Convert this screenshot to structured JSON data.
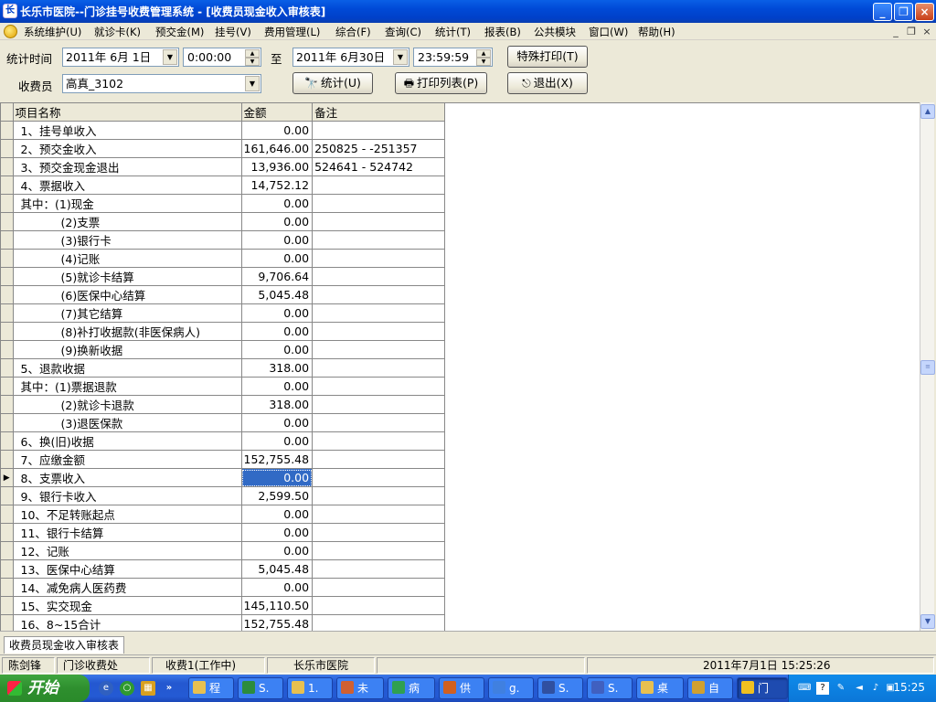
{
  "window": {
    "title": "长乐市医院--门诊挂号收费管理系统 - [收费员现金收入审核表]"
  },
  "menu": [
    "系统维护(U)",
    "就诊卡(K)",
    "预交金(M)",
    "挂号(V)",
    "费用管理(L)",
    "综合(F)",
    "查询(C)",
    "统计(T)",
    "报表(B)",
    "公共模块",
    "窗口(W)",
    "帮助(H)"
  ],
  "filters": {
    "period_label": "统计时间",
    "start_date": "2011年 6月 1日",
    "start_time": "0:00:00",
    "to_label": "至",
    "end_date": "2011年 6月30日",
    "end_time": "23:59:59",
    "cashier_label": "收费员",
    "cashier_value": "高真_3102"
  },
  "buttons": {
    "special_print": "特殊打印(T)",
    "stats": "统计(U)",
    "print_list": "打印列表(P)",
    "exit": "退出(X)"
  },
  "grid": {
    "headers": [
      "项目名称",
      "金额",
      "备注"
    ],
    "selected_row": 22,
    "rows": [
      {
        "name": "1、挂号单收入",
        "amount": "0.00",
        "note": "",
        "level": 0
      },
      {
        "name": "2、预交金收入",
        "amount": "161,646.00",
        "note": "250825 - -251357",
        "level": 0
      },
      {
        "name": "3、预交金现金退出",
        "amount": "13,936.00",
        "note": "524641 - 524742",
        "level": 0
      },
      {
        "name": "4、票据收入",
        "amount": "14,752.12",
        "note": "",
        "level": 0
      },
      {
        "name": "其中：(1)现金",
        "amount": "0.00",
        "note": "",
        "level": 1
      },
      {
        "name": "(2)支票",
        "amount": "0.00",
        "note": "",
        "level": 2
      },
      {
        "name": "(3)银行卡",
        "amount": "0.00",
        "note": "",
        "level": 2
      },
      {
        "name": "(4)记账",
        "amount": "0.00",
        "note": "",
        "level": 2
      },
      {
        "name": "(5)就诊卡结算",
        "amount": "9,706.64",
        "note": "",
        "level": 2
      },
      {
        "name": "(6)医保中心结算",
        "amount": "5,045.48",
        "note": "",
        "level": 2
      },
      {
        "name": "(7)其它结算",
        "amount": "0.00",
        "note": "",
        "level": 2
      },
      {
        "name": "(8)补打收据款(非医保病人)",
        "amount": "0.00",
        "note": "",
        "level": 2
      },
      {
        "name": "(9)换新收据",
        "amount": "0.00",
        "note": "",
        "level": 2
      },
      {
        "name": "5、退款收据",
        "amount": "318.00",
        "note": "",
        "level": 0
      },
      {
        "name": "其中：(1)票据退款",
        "amount": "0.00",
        "note": "",
        "level": 1
      },
      {
        "name": "(2)就诊卡退款",
        "amount": "318.00",
        "note": "",
        "level": 2
      },
      {
        "name": "(3)退医保款",
        "amount": "0.00",
        "note": "",
        "level": 2
      },
      {
        "name": "6、换(旧)收据",
        "amount": "0.00",
        "note": "",
        "level": 0
      },
      {
        "name": "7、应缴金额",
        "amount": "152,755.48",
        "note": "",
        "level": 0
      },
      {
        "name": "8、支票收入",
        "amount": "0.00",
        "note": "",
        "level": 0
      },
      {
        "name": "9、银行卡收入",
        "amount": "2,599.50",
        "note": "",
        "level": 0
      },
      {
        "name": "10、不足转账起点",
        "amount": "0.00",
        "note": "",
        "level": 0
      },
      {
        "name": "11、银行卡结算",
        "amount": "0.00",
        "note": "",
        "level": 0
      },
      {
        "name": "12、记账",
        "amount": "0.00",
        "note": "",
        "level": 0
      },
      {
        "name": "13、医保中心结算",
        "amount": "5,045.48",
        "note": "",
        "level": 0
      },
      {
        "name": "14、减免病人医药费",
        "amount": "0.00",
        "note": "",
        "level": 0
      },
      {
        "name": "15、实交现金",
        "amount": "145,110.50",
        "note": "",
        "level": 0
      },
      {
        "name": "16、8~15合计",
        "amount": "152,755.48",
        "note": "",
        "level": 0
      }
    ]
  },
  "tab": "收费员现金收入审核表",
  "status": {
    "user": "陈剑锋",
    "dept": "门诊收费处",
    "station": "收费1(工作中)",
    "hospital": "长乐市医院",
    "datetime": "2011年7月1日  15:25:26"
  },
  "taskbar": {
    "start": "开始",
    "tasks": [
      "程",
      "S.",
      "1.",
      "未",
      "病",
      "供",
      "g.",
      "S.",
      "S.",
      "桌",
      "自",
      "门"
    ],
    "active_task": "门",
    "clock": "15:25"
  }
}
